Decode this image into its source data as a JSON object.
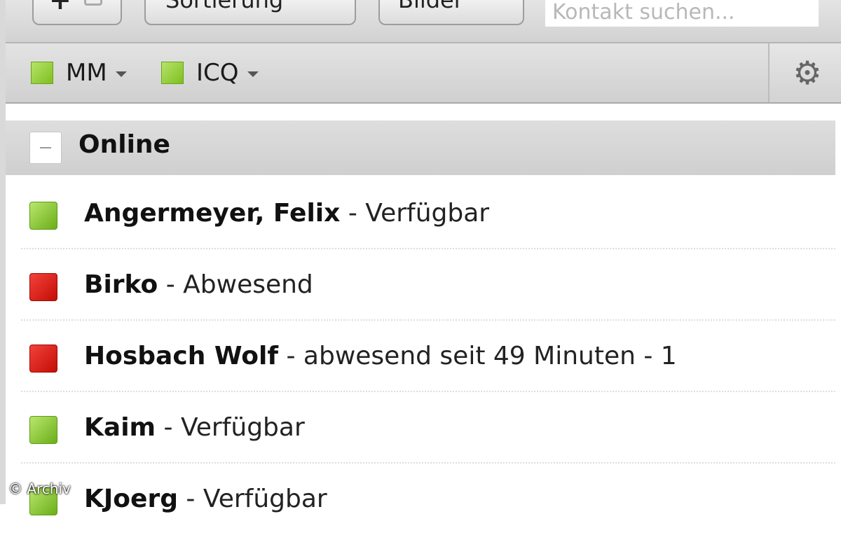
{
  "toolbar": {
    "add_icon": "plus-person-icon",
    "sort_label": "Sortierung",
    "images_label": "Bilder",
    "search_placeholder": "Kontakt suchen..."
  },
  "accounts": [
    {
      "label": "MM",
      "status_color": "#8ccc2a"
    },
    {
      "label": "ICQ",
      "status_color": "#8ccc2a"
    }
  ],
  "settings_icon": "gear-icon",
  "group": {
    "title": "Online",
    "collapse_icon": "minus-icon"
  },
  "contacts": [
    {
      "name": "Angermeyer, Felix",
      "message": "Verfügbar",
      "status": "green"
    },
    {
      "name": "Birko",
      "message": "Abwesend",
      "status": "red"
    },
    {
      "name": "Hosbach Wolf",
      "message": "abwesend seit 49 Minuten - 1",
      "status": "red"
    },
    {
      "name": "Kaim",
      "message": "Verfügbar",
      "status": "green"
    },
    {
      "name": "KJoerg",
      "message": "Verfügbar",
      "status": "green"
    }
  ],
  "watermark": "© Archiv"
}
